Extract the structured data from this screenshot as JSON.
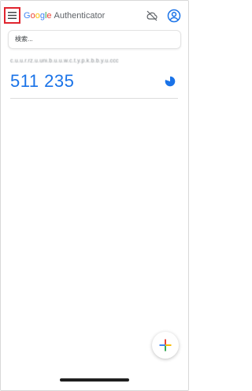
{
  "app": {
    "brand_letters": [
      "G",
      "o",
      "o",
      "g",
      "l",
      "e"
    ],
    "brand_suffix": "Authenticator"
  },
  "search": {
    "placeholder": "検索..."
  },
  "accounts": [
    {
      "name": "c.u.u.r.rz.u.uni.b.u.u.w.c.t.y.p.k.b.b.y.u.ccc",
      "code": "511 235",
      "timer_remaining": 0.8
    }
  ],
  "icons": {
    "menu": "menu-icon",
    "cloud": "cloud-off-icon",
    "account": "account-circle-icon",
    "timer": "timer-pie-icon",
    "add": "plus-icon"
  },
  "colors": {
    "accent": "#1a73e8",
    "highlight_border": "#e0252f",
    "google_blue": "#4285F4",
    "google_red": "#EA4335",
    "google_yellow": "#FBBC05",
    "google_green": "#34A853"
  }
}
